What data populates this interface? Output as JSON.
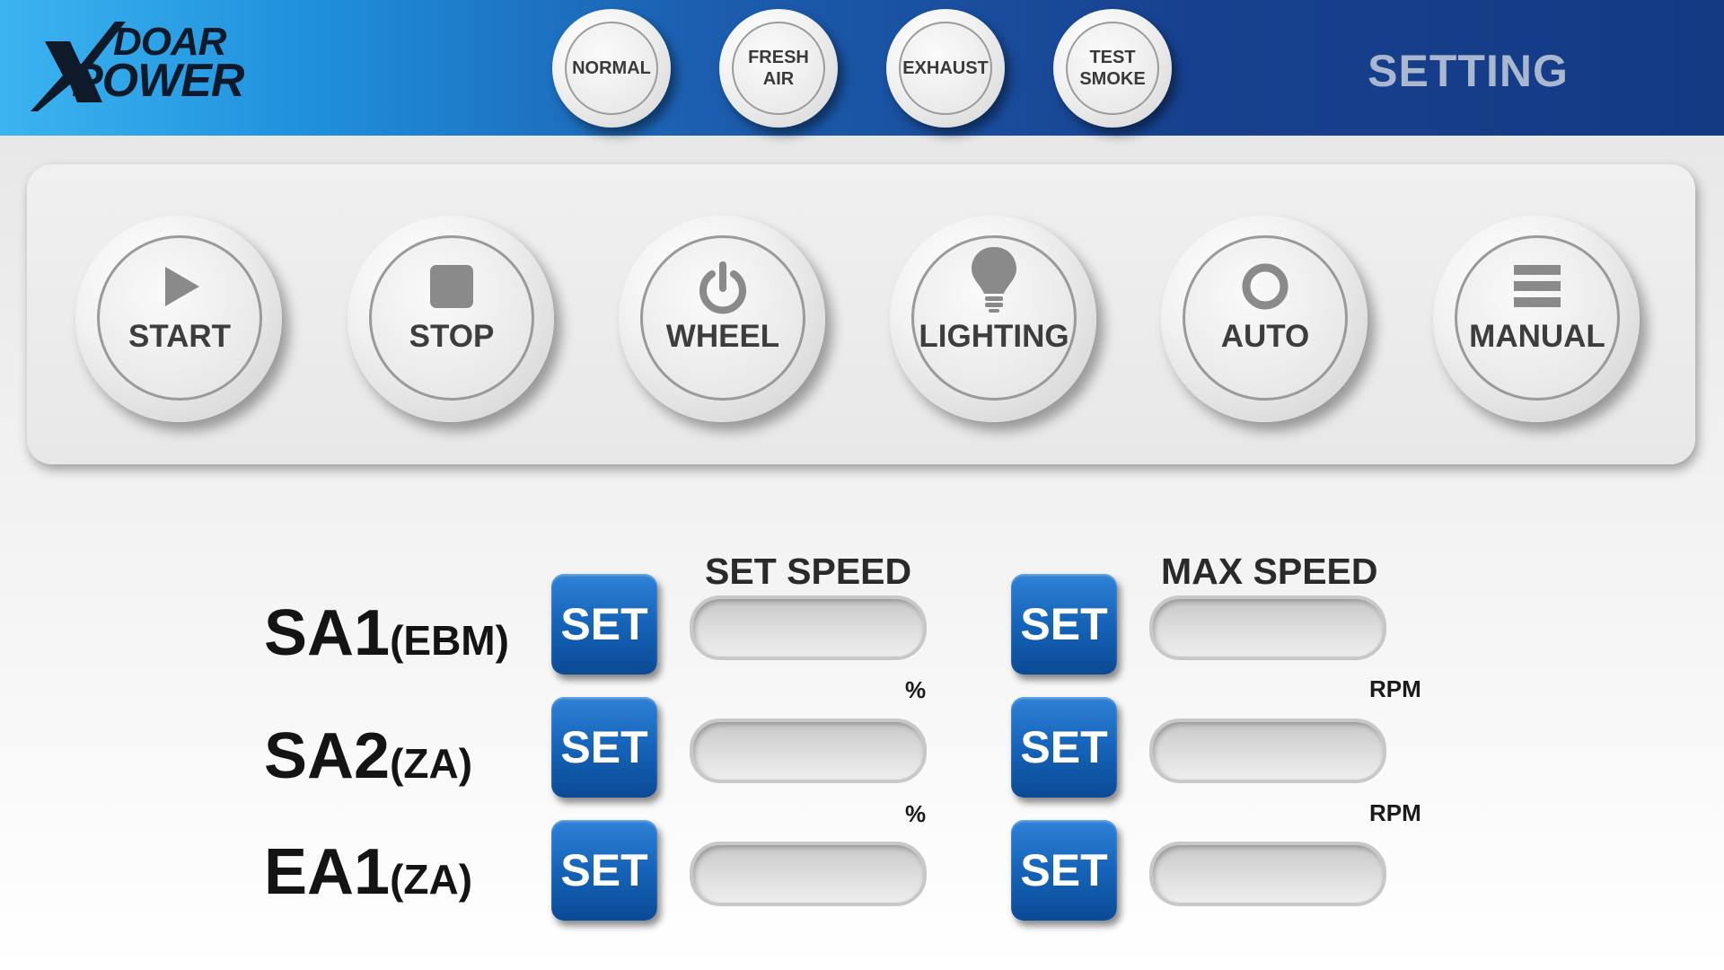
{
  "header": {
    "logo": {
      "line1": "DOAR",
      "line2": "POWER",
      "mark": "X"
    },
    "modes": [
      {
        "label": "NORMAL"
      },
      {
        "label": "FRESH\nAIR"
      },
      {
        "label": "EXHAUST"
      },
      {
        "label": "TEST\nSMOKE"
      }
    ],
    "title": "SETTING"
  },
  "controls": [
    {
      "label": "START",
      "icon": "play-icon"
    },
    {
      "label": "STOP",
      "icon": "stop-icon"
    },
    {
      "label": "WHEEL",
      "icon": "power-icon"
    },
    {
      "label": "LIGHTING",
      "icon": "light-bulb-icon"
    },
    {
      "label": "AUTO",
      "icon": "ring-icon"
    },
    {
      "label": "MANUAL",
      "icon": "menu-lines-icon"
    }
  ],
  "speed": {
    "set_speed_header": "SET SPEED",
    "max_speed_header": "MAX SPEED",
    "set_label": "SET",
    "rows": [
      {
        "name": "SA1",
        "sub": "(EBM)",
        "set_speed_value": "",
        "max_speed_value": ""
      },
      {
        "name": "SA2",
        "sub": "(ZA)",
        "set_speed_value": "",
        "max_speed_value": ""
      },
      {
        "name": "EA1",
        "sub": "(ZA)",
        "set_speed_value": "",
        "max_speed_value": ""
      }
    ],
    "units": {
      "set_speed": "%",
      "max_speed": "RPM"
    }
  },
  "colors": {
    "header_start": "#3cb4f0",
    "header_end": "#143a84",
    "set_button": "#1563b8",
    "title_text": "#a9b8cf"
  }
}
